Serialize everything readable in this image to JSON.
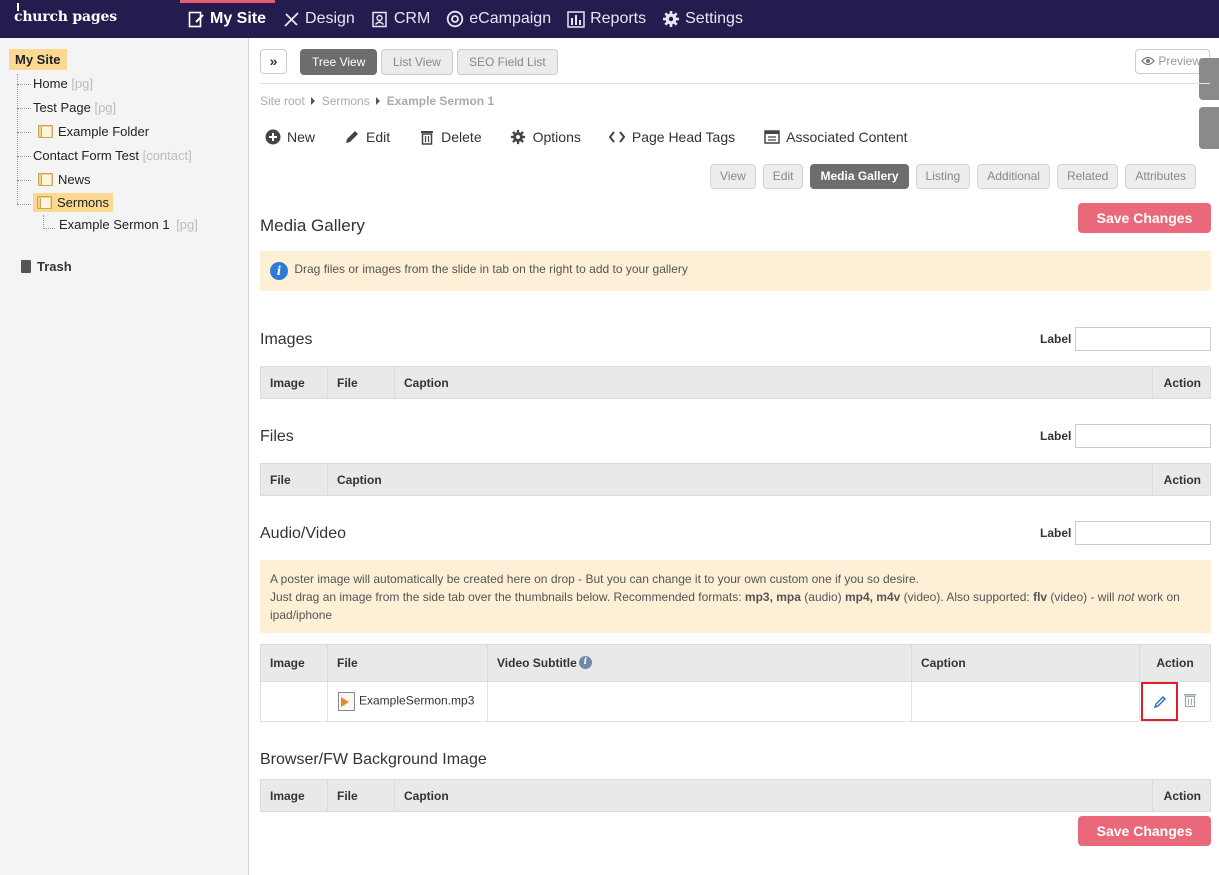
{
  "app": {
    "logo": "church pages"
  },
  "nav": [
    {
      "label": "My Site",
      "icon": "page-edit-icon",
      "active": true
    },
    {
      "label": "Design",
      "icon": "design-tools-icon"
    },
    {
      "label": "CRM",
      "icon": "contacts-icon"
    },
    {
      "label": "eCampaign",
      "icon": "at-sign-icon"
    },
    {
      "label": "Reports",
      "icon": "bar-chart-icon"
    },
    {
      "label": "Settings",
      "icon": "gear-icon"
    }
  ],
  "sidebar": {
    "root": "My Site",
    "items": [
      {
        "label": "Home",
        "tag": "[pg]"
      },
      {
        "label": "Test Page",
        "tag": "[pg]"
      },
      {
        "label": "Example Folder",
        "tag": ""
      },
      {
        "label": "Contact Form Test",
        "tag": "[contact]"
      },
      {
        "label": "News",
        "tag": ""
      },
      {
        "label": "Sermons",
        "tag": ""
      },
      {
        "label": "Example Sermon 1",
        "tag": "[pg]"
      }
    ],
    "trash": "Trash"
  },
  "toolbar": {
    "views": [
      "Tree View",
      "List View",
      "SEO Field List"
    ],
    "preview": "Preview"
  },
  "breadcrumb": [
    "Site root",
    "Sermons",
    "Example Sermon 1"
  ],
  "actions": [
    "New",
    "Edit",
    "Delete",
    "Options",
    "Page Head Tags",
    "Associated Content"
  ],
  "subtabs": [
    "View",
    "Edit",
    "Media Gallery",
    "Listing",
    "Additional",
    "Related",
    "Attributes"
  ],
  "page": {
    "title": "Media Gallery",
    "save_label": "Save Changes",
    "info": "Drag files or images from the slide in tab on the right to add to your gallery",
    "label_text": "Label"
  },
  "sections": {
    "images": {
      "title": "Images",
      "columns": [
        "Image",
        "File",
        "Caption",
        "Action"
      ]
    },
    "files": {
      "title": "Files",
      "columns": [
        "File",
        "Caption",
        "Action"
      ]
    },
    "audio": {
      "title": "Audio/Video",
      "note_line1": "A poster image will automatically be created here on drop - But you can change it to your own custom one if you so desire.",
      "note_line2a": "Just drag an image from the side tab over the thumbnails below. Recommended formats: ",
      "fmt_a": "mp3, mpa",
      "note_line2b": " (audio) ",
      "fmt_b": "mp4, m4v",
      "note_line2c": " (video). Also supported: ",
      "fmt_c": "flv",
      "note_line2d": " (video) - will ",
      "note_not": "not",
      "note_line2e": " work on",
      "note_line3": "ipad/iphone",
      "columns": [
        "Image",
        "File",
        "Video Subtitle",
        "Caption",
        "Action"
      ],
      "row_file": "ExampleSermon.mp3"
    },
    "background": {
      "title": "Browser/FW Background Image",
      "columns": [
        "Image",
        "File",
        "Caption",
        "Action"
      ]
    }
  }
}
